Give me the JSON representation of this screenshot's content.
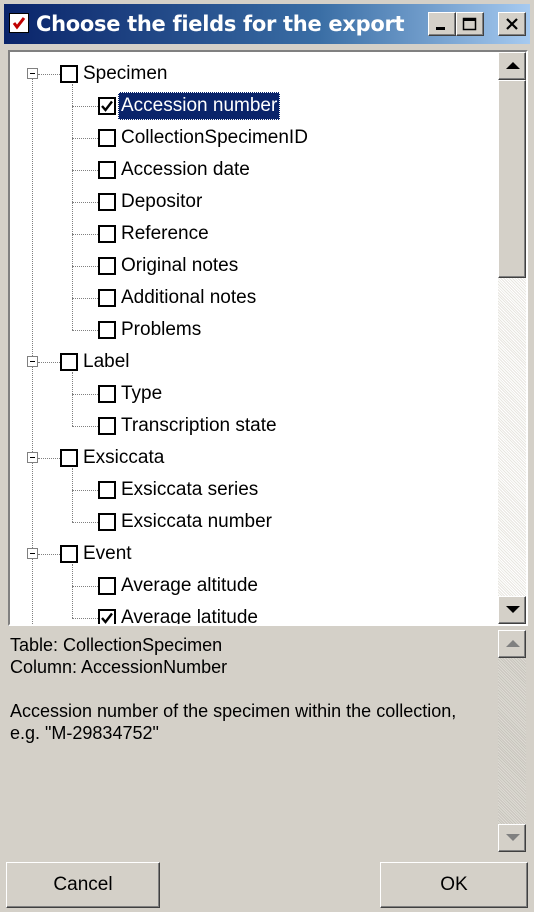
{
  "window": {
    "title": "Choose the fields for the export",
    "controls": {
      "minimize_icon": "minimize-icon",
      "maximize_icon": "maximize-icon",
      "close_icon": "close-icon"
    }
  },
  "tree": {
    "nodes": [
      {
        "label": "Specimen",
        "level": 0,
        "checked": false,
        "expanded": true,
        "selected": false
      },
      {
        "label": "Accession number",
        "level": 1,
        "checked": true,
        "selected": true
      },
      {
        "label": "CollectionSpecimenID",
        "level": 1,
        "checked": false,
        "selected": false
      },
      {
        "label": "Accession date",
        "level": 1,
        "checked": false,
        "selected": false
      },
      {
        "label": "Depositor",
        "level": 1,
        "checked": false,
        "selected": false
      },
      {
        "label": "Reference",
        "level": 1,
        "checked": false,
        "selected": false
      },
      {
        "label": "Original notes",
        "level": 1,
        "checked": false,
        "selected": false
      },
      {
        "label": "Additional notes",
        "level": 1,
        "checked": false,
        "selected": false
      },
      {
        "label": "Problems",
        "level": 1,
        "checked": false,
        "selected": false
      },
      {
        "label": "Label",
        "level": 0,
        "checked": false,
        "expanded": true,
        "selected": false
      },
      {
        "label": "Type",
        "level": 1,
        "checked": false,
        "selected": false
      },
      {
        "label": "Transcription state",
        "level": 1,
        "checked": false,
        "selected": false
      },
      {
        "label": "Exsiccata",
        "level": 0,
        "checked": false,
        "expanded": true,
        "selected": false
      },
      {
        "label": "Exsiccata series",
        "level": 1,
        "checked": false,
        "selected": false
      },
      {
        "label": "Exsiccata number",
        "level": 1,
        "checked": false,
        "selected": false
      },
      {
        "label": "Event",
        "level": 0,
        "checked": false,
        "expanded": true,
        "selected": false
      },
      {
        "label": "Average altitude",
        "level": 1,
        "checked": false,
        "selected": false
      },
      {
        "label": "Average latitude",
        "level": 1,
        "checked": true,
        "selected": false
      }
    ]
  },
  "description": {
    "text": "Table: CollectionSpecimen\nColumn: AccessionNumber\n\nAccession number of the specimen within the collection, e.g. \"M-29834752\""
  },
  "buttons": {
    "cancel": "Cancel",
    "ok": "OK"
  },
  "colors": {
    "title_start": "#0a246a",
    "title_end": "#a6caf0",
    "selection": "#0a246a",
    "face": "#d4d0c8"
  }
}
